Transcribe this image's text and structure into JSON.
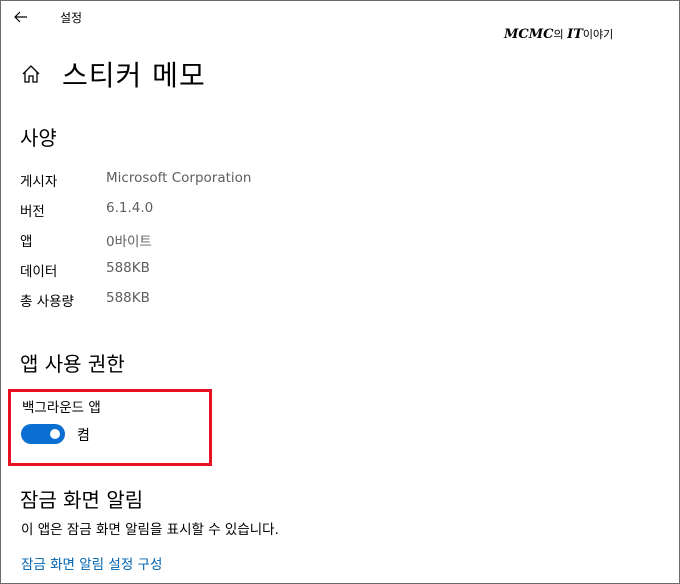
{
  "window": {
    "app_title": "설정"
  },
  "watermark": {
    "part1": "MCMC",
    "part2": "의 ",
    "part3": "IT",
    "part4": "이야기"
  },
  "header": {
    "title": "스티커 메모"
  },
  "specs": {
    "section_title": "사양",
    "rows": [
      {
        "label": "게시자",
        "value": "Microsoft Corporation"
      },
      {
        "label": "버전",
        "value": "6.1.4.0"
      },
      {
        "label": "앱",
        "value": "0바이트"
      },
      {
        "label": "데이터",
        "value": "588KB"
      },
      {
        "label": "총 사용량",
        "value": "588KB"
      }
    ]
  },
  "permissions": {
    "section_title": "앱 사용 권한",
    "background_label": "백그라운드 앱",
    "toggle_state": "켬",
    "toggle_on": true
  },
  "lock_screen": {
    "section_title": "잠금 화면 알림",
    "description": "이 앱은 잠금 화면 알림을 표시할 수 있습니다.",
    "link": "잠금 화면 알림 설정 구성"
  },
  "colors": {
    "accent": "#0a6fd1",
    "highlight": "#e81123",
    "link": "#0063b1",
    "secondary_text": "#5f5f5f"
  }
}
